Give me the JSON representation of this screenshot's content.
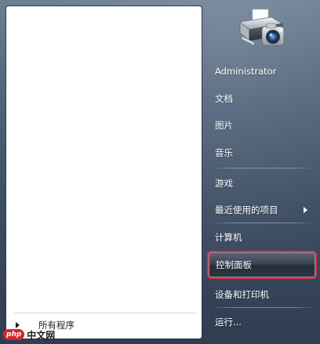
{
  "left_pane": {
    "all_programs_label": "所有程序"
  },
  "right_pane": {
    "username": "Administrator",
    "items": [
      {
        "label": "文档"
      },
      {
        "label": "图片"
      },
      {
        "label": "音乐"
      },
      {
        "label": "游戏"
      },
      {
        "label": "最近使用的项目"
      },
      {
        "label": "计算机"
      },
      {
        "label": "控制面板"
      },
      {
        "label": "设备和打印机"
      },
      {
        "label": "运行..."
      }
    ],
    "highlighted_item": "控制面板",
    "user_picture_icon": "printer-camera-icon"
  },
  "watermark": {
    "logo": "php",
    "text": "中文网"
  },
  "colors": {
    "highlight_border": "#d7343d",
    "menu_background": "#4f6279",
    "left_pane_background": "#ffffff"
  }
}
